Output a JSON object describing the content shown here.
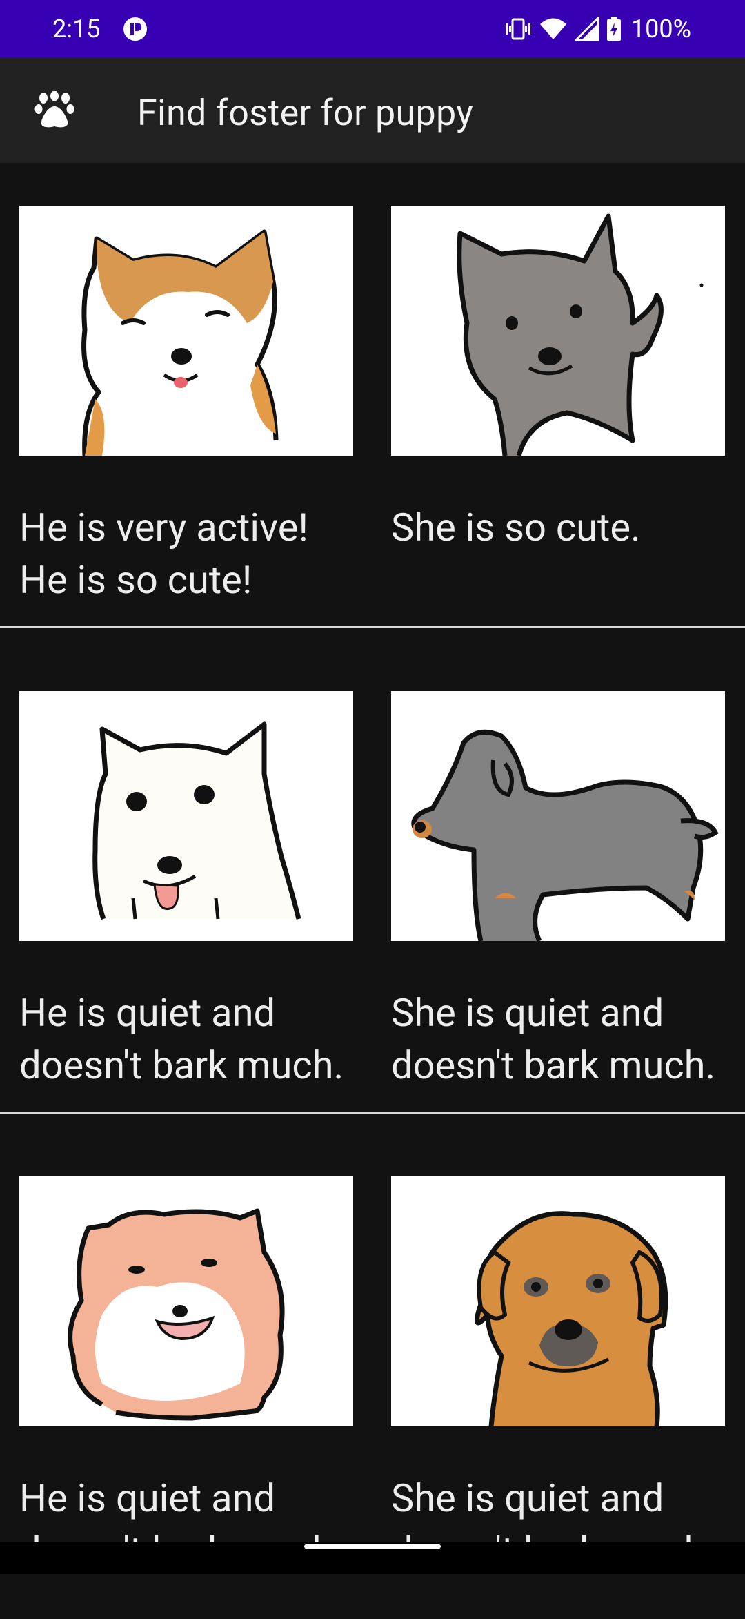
{
  "status_bar": {
    "time": "2:15",
    "battery_percent": "100%",
    "icons": [
      "app-notification-icon",
      "vibrate-icon",
      "wifi-icon",
      "cell-signal-icon",
      "battery-icon"
    ],
    "background": "#3700B3"
  },
  "app_bar": {
    "title": "Find foster for puppy",
    "logo_icon": "paw-icon",
    "background": "#212121"
  },
  "puppies": [
    {
      "description": "He is very active! He is so cute!",
      "image": "shiba-puppy-drawing"
    },
    {
      "description": "She is so cute.",
      "image": "gray-puppy-drawing"
    },
    {
      "description": "He is quiet and doesn't bark much.",
      "image": "white-puppy-drawing"
    },
    {
      "description": "She is quiet and doesn't bark much.",
      "image": "dachshund-drawing"
    },
    {
      "description": "He is quiet and doesn't bark much.",
      "image": "pomeranian-drawing"
    },
    {
      "description": "She is quiet and doesn't bark much.",
      "image": "brown-puppy-drawing"
    }
  ],
  "navigation": {
    "gesture_handle": "home-handle"
  },
  "colors": {
    "background": "#121212",
    "card_image_background": "#FFFFFF",
    "divider": "#D8D8D8"
  }
}
